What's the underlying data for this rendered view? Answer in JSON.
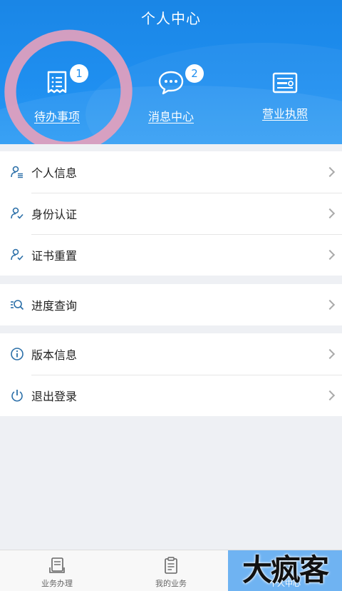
{
  "header": {
    "title": "个人中心",
    "quick_actions": [
      {
        "label": "待办事项",
        "badge": "1"
      },
      {
        "label": "消息中心",
        "badge": "2"
      },
      {
        "label": "营业执照"
      }
    ]
  },
  "groups": [
    {
      "items": [
        {
          "label": "个人信息"
        },
        {
          "label": "身份认证"
        },
        {
          "label": "证书重置"
        }
      ]
    },
    {
      "items": [
        {
          "label": "进度查询"
        }
      ]
    },
    {
      "items": [
        {
          "label": "版本信息"
        },
        {
          "label": "退出登录"
        }
      ]
    }
  ],
  "tabbar": {
    "tabs": [
      {
        "label": "业务办理"
      },
      {
        "label": "我的业务"
      },
      {
        "label": "个人中心"
      }
    ]
  },
  "watermark": "大疯客",
  "colors": {
    "primary": "#1f8ff0",
    "header_gradient_top": "#1a86e6",
    "annotation_pink": "#e8a0bb",
    "background": "#eef0f4",
    "icon_blue": "#2b6fa8"
  }
}
